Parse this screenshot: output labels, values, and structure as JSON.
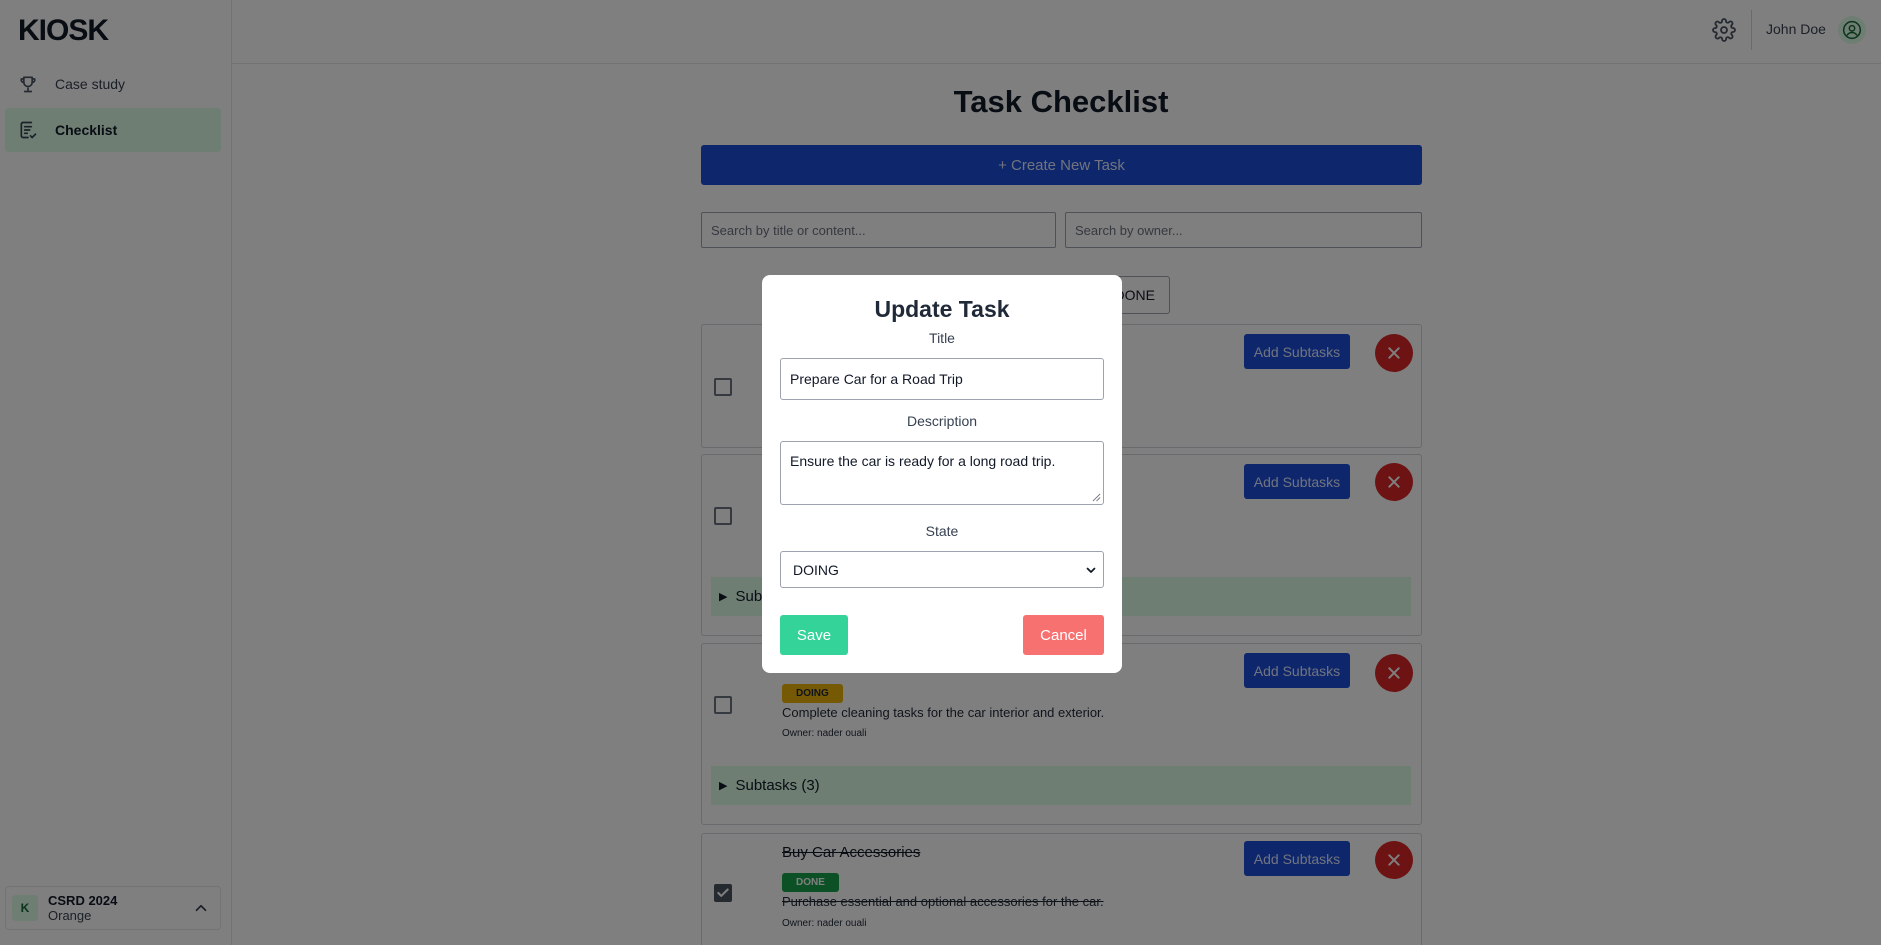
{
  "sidebar": {
    "logo": "KIOSK",
    "items": [
      {
        "label": "Case study",
        "icon": "trophy-icon"
      },
      {
        "label": "Checklist",
        "icon": "checklist-icon",
        "active": true
      }
    ],
    "org": {
      "initial": "K",
      "name": "CSRD 2024",
      "sub": "Orange"
    }
  },
  "header": {
    "user_name": "John Doe"
  },
  "main": {
    "title": "Task Checklist",
    "create_label": "+ Create New Task",
    "search_title_placeholder": "Search by title or content...",
    "search_owner_placeholder": "Search by owner...",
    "filter_done_label": "DONE",
    "add_subtasks_label": "Add Subtasks",
    "tasks": [
      {
        "checked": false
      },
      {
        "checked": false,
        "subtasks_label": "Sub"
      },
      {
        "checked": false,
        "state": "DOING",
        "description": "Complete cleaning tasks for the car interior and exterior.",
        "owner": "Owner: nader ouali",
        "subtasks_label": "Subtasks (3)"
      },
      {
        "checked": true,
        "title": "Buy Car Accessories",
        "state": "DONE",
        "description": "Purchase essential and optional accessories for the car.",
        "owner": "Owner: nader ouali"
      }
    ]
  },
  "modal": {
    "heading": "Update Task",
    "title_label": "Title",
    "title_value": "Prepare Car for a Road Trip",
    "description_label": "Description",
    "description_value": "Ensure the car is ready for a long road trip.",
    "state_label": "State",
    "state_value": "DOING",
    "save_label": "Save",
    "cancel_label": "Cancel"
  },
  "colors": {
    "primary": "#1d4ed8",
    "accent_green": "#dcfce7",
    "save": "#34d399",
    "cancel": "#f87171",
    "delete": "#dc2626",
    "doing": "#eab308",
    "done": "#16a34a"
  }
}
